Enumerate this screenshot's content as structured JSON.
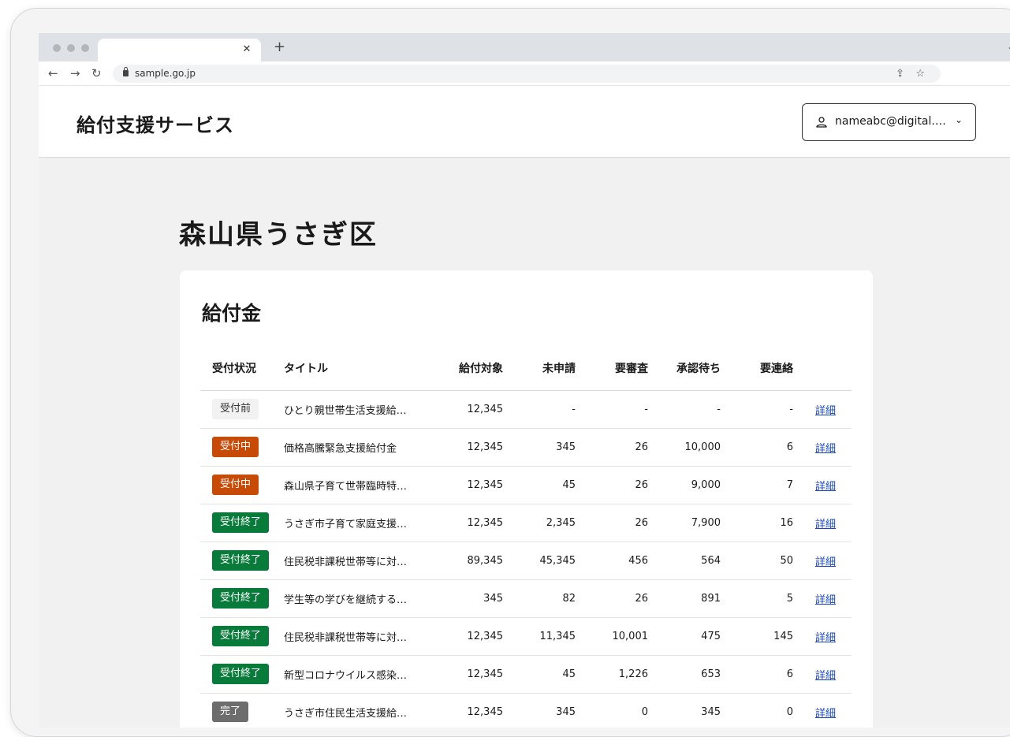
{
  "browser": {
    "url": "sample.go.jp",
    "icons": {
      "back": "back-arrow-icon",
      "forward": "forward-arrow-icon",
      "reload": "reload-icon",
      "share": "share-icon",
      "bookmark": "star-icon",
      "close_tab": "close-icon",
      "new_tab": "plus-icon",
      "tab_menu": "chevron-down-icon"
    }
  },
  "header": {
    "service_name": "給付支援サービス",
    "account_label": "nameabc@digital.…",
    "account_icon": "person-icon"
  },
  "page": {
    "title": "森山県うさぎ区",
    "card_title": "給付金"
  },
  "table": {
    "headers": {
      "status": "受付状況",
      "title": "タイトル",
      "target": "給付対象",
      "unapplied": "未申請",
      "review": "要審査",
      "approval": "承認待ち",
      "contact": "要連絡"
    },
    "rows": [
      {
        "status": "受付前",
        "status_type": "before",
        "title": "ひとり親世帯生活支援給…",
        "target": "12,345",
        "unapplied": "-",
        "review": "-",
        "approval": "-",
        "contact": "-",
        "link": "詳細"
      },
      {
        "status": "受付中",
        "status_type": "open",
        "title": "価格高騰緊急支援給付金",
        "target": "12,345",
        "unapplied": "345",
        "review": "26",
        "approval": "10,000",
        "contact": "6",
        "link": "詳細"
      },
      {
        "status": "受付中",
        "status_type": "open",
        "title": "森山県子育て世帯臨時特…",
        "target": "12,345",
        "unapplied": "45",
        "review": "26",
        "approval": "9,000",
        "contact": "7",
        "link": "詳細"
      },
      {
        "status": "受付終了",
        "status_type": "closed",
        "title": "うさぎ市子育て家庭支援…",
        "target": "12,345",
        "unapplied": "2,345",
        "review": "26",
        "approval": "7,900",
        "contact": "16",
        "link": "詳細"
      },
      {
        "status": "受付終了",
        "status_type": "closed",
        "title": "住民税非課税世帯等に対…",
        "target": "89,345",
        "unapplied": "45,345",
        "review": "456",
        "approval": "564",
        "contact": "50",
        "link": "詳細"
      },
      {
        "status": "受付終了",
        "status_type": "closed",
        "title": "学生等の学びを継続する…",
        "target": "345",
        "unapplied": "82",
        "review": "26",
        "approval": "891",
        "contact": "5",
        "link": "詳細"
      },
      {
        "status": "受付終了",
        "status_type": "closed",
        "title": "住民税非課税世帯等に対…",
        "target": "12,345",
        "unapplied": "11,345",
        "review": "10,001",
        "approval": "475",
        "contact": "145",
        "link": "詳細"
      },
      {
        "status": "受付終了",
        "status_type": "closed",
        "title": "新型コロナウイルス感染…",
        "target": "12,345",
        "unapplied": "45",
        "review": "1,226",
        "approval": "653",
        "contact": "6",
        "link": "詳細"
      },
      {
        "status": "完了",
        "status_type": "done",
        "title": "うさぎ市住民生活支援給…",
        "target": "12,345",
        "unapplied": "345",
        "review": "0",
        "approval": "345",
        "contact": "0",
        "link": "詳細"
      }
    ]
  },
  "colors": {
    "badge_open": "#c84a07",
    "badge_closed": "#087a3a",
    "badge_done": "#6d6d6d",
    "badge_before": "#f2f2f2",
    "link": "#1a47b8"
  }
}
